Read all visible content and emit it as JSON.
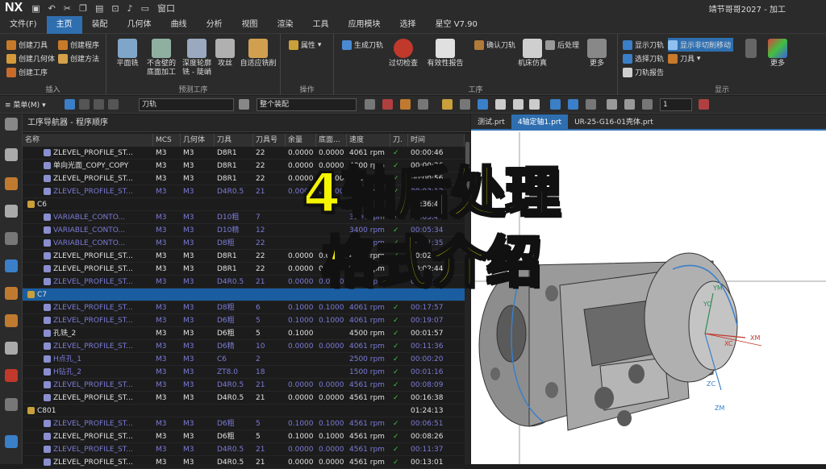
{
  "app": {
    "logo": "NX",
    "window_title": "靖节哥哥2027 - 加工",
    "window_menu": "窗口"
  },
  "menu": [
    "文件(F)",
    "主页",
    "装配",
    "几何体",
    "曲线",
    "分析",
    "视图",
    "渲染",
    "工具",
    "应用模块",
    "选择",
    "星空 V7.90"
  ],
  "menu_active_index": 1,
  "ribbon": {
    "insert": {
      "label": "插入",
      "items": [
        "创建刀具",
        "创建几何体",
        "创建工序",
        "创建程序",
        "创建方法"
      ]
    },
    "predefined": {
      "label": "预测工序",
      "items": [
        "平面铣",
        "不含壁的底面加工",
        "深度轮廓铣 - 陡峭",
        "攻丝",
        "自适应铣削"
      ]
    },
    "operation": {
      "label": "操作",
      "items": [
        "属性"
      ]
    },
    "process": {
      "label": "工序",
      "items": [
        "生成刀轨",
        "确认刀轨",
        "后处理",
        "过切检查",
        "有效性报告",
        "机床仿真",
        "更多"
      ]
    },
    "display": {
      "label": "显示",
      "items": [
        "显示刀轨",
        "显示非切削移动",
        "选择刀轨",
        "刀具",
        "刀轨报告",
        "更多"
      ]
    }
  },
  "toolbar2": {
    "menu": "菜单(M)",
    "filter": "刀轨",
    "scope": "整个装配",
    "count": "1"
  },
  "navigator": {
    "title": "工序导航器 - 程序顺序",
    "columns": [
      "名称",
      "MCS",
      "几何体",
      "刀具",
      "刀具号",
      "余量",
      "底面...",
      "速度",
      "刀.",
      "时间"
    ],
    "rows": [
      {
        "n": "ZLEVEL_PROFILE_ST...",
        "mcs": "M3",
        "g": "M3",
        "t": "D8R1",
        "no": "22",
        "r": "0.0000",
        "f": "0.0000",
        "s": "4061 rpm",
        "c": "✓",
        "time": "00:00:46",
        "lvl": 2
      },
      {
        "n": "单向光面_COPY_COPY",
        "mcs": "M3",
        "g": "M3",
        "t": "D8R1",
        "no": "22",
        "r": "0.0000",
        "f": "0.0000",
        "s": "4000 rpm",
        "c": "✓",
        "time": "00:00:26",
        "lvl": 2
      },
      {
        "n": "ZLEVEL_PROFILE_ST...",
        "mcs": "M3",
        "g": "M3",
        "t": "D8R1",
        "no": "22",
        "r": "0.0000",
        "f": "0.0000",
        "s": "4061 rpm",
        "c": "✓",
        "time": "00:00:56",
        "lvl": 2
      },
      {
        "n": "ZLEVEL_PROFILE_ST...",
        "mcs": "M3",
        "g": "M3",
        "t": "D4R0.5",
        "no": "21",
        "r": "0.0000",
        "f": "0.0000",
        "s": "4561 rpm",
        "c": "✓",
        "time": "00:03:12",
        "lvl": 2,
        "dim": true
      },
      {
        "n": "C6",
        "mcs": "",
        "g": "",
        "t": "",
        "no": "",
        "r": "",
        "f": "",
        "s": "",
        "c": "",
        "time": "01:36:45",
        "lvl": 1
      },
      {
        "n": "VARIABLE_CONTO...",
        "mcs": "M3",
        "g": "M3",
        "t": "D10粗",
        "no": "7",
        "r": "",
        "f": "",
        "s": "3200 rpm",
        "c": "✓",
        "time": "00:05:47",
        "lvl": 2,
        "dim": true
      },
      {
        "n": "VARIABLE_CONTO...",
        "mcs": "M3",
        "g": "M3",
        "t": "D10精",
        "no": "12",
        "r": "",
        "f": "",
        "s": "3400 rpm",
        "c": "✓",
        "time": "00:05:34",
        "lvl": 2,
        "dim": true
      },
      {
        "n": "VARIABLE_CONTO...",
        "mcs": "M3",
        "g": "M3",
        "t": "D8粗",
        "no": "22",
        "r": "",
        "f": "",
        "s": "3400 rpm",
        "c": "✓",
        "time": "00:11:35",
        "lvl": 2,
        "dim": true
      },
      {
        "n": "ZLEVEL_PROFILE_ST...",
        "mcs": "M3",
        "g": "M3",
        "t": "D8R1",
        "no": "22",
        "r": "0.0000",
        "f": "0.0000",
        "s": "4061 rpm",
        "c": "✓",
        "time": "00:02:12",
        "lvl": 2
      },
      {
        "n": "ZLEVEL_PROFILE_ST...",
        "mcs": "M3",
        "g": "M3",
        "t": "D8R1",
        "no": "22",
        "r": "0.0000",
        "f": "0.0000",
        "s": "4061 rpm",
        "c": "✓",
        "time": "00:02:44",
        "lvl": 2
      },
      {
        "n": "ZLEVEL_PROFILE_ST...",
        "mcs": "M3",
        "g": "M3",
        "t": "D4R0.5",
        "no": "21",
        "r": "0.0000",
        "f": "0.0000",
        "s": "4561 rpm",
        "c": "✓",
        "time": "00:03:47",
        "lvl": 2,
        "dim": true
      },
      {
        "n": "C7",
        "mcs": "",
        "g": "",
        "t": "",
        "no": "",
        "r": "",
        "f": "",
        "s": "",
        "c": "",
        "time": "",
        "lvl": 1,
        "sel": true
      },
      {
        "n": "ZLEVEL_PROFILE_ST...",
        "mcs": "M3",
        "g": "M3",
        "t": "D8粗",
        "no": "6",
        "r": "0.1000",
        "f": "0.1000",
        "s": "4061 rpm",
        "c": "✓",
        "time": "00:17:57",
        "lvl": 2,
        "dim": true
      },
      {
        "n": "ZLEVEL_PROFILE_ST...",
        "mcs": "M3",
        "g": "M3",
        "t": "D6粗",
        "no": "5",
        "r": "0.1000",
        "f": "0.1000",
        "s": "4061 rpm",
        "c": "✓",
        "time": "00:19:07",
        "lvl": 2,
        "dim": true
      },
      {
        "n": "孔铣_2",
        "mcs": "M3",
        "g": "M3",
        "t": "D6粗",
        "no": "5",
        "r": "0.1000",
        "f": "",
        "s": "4500 rpm",
        "c": "✓",
        "time": "00:01:57",
        "lvl": 2
      },
      {
        "n": "ZLEVEL_PROFILE_ST...",
        "mcs": "M3",
        "g": "M3",
        "t": "D6精",
        "no": "10",
        "r": "0.0000",
        "f": "0.0000",
        "s": "4061 rpm",
        "c": "✓",
        "time": "00:11:36",
        "lvl": 2,
        "dim": true
      },
      {
        "n": "H点孔_1",
        "mcs": "M3",
        "g": "M3",
        "t": "C6",
        "no": "2",
        "r": "",
        "f": "",
        "s": "2500 rpm",
        "c": "✓",
        "time": "00:00:20",
        "lvl": 2,
        "dim": true
      },
      {
        "n": "H钻孔_2",
        "mcs": "M3",
        "g": "M3",
        "t": "ZT8.0",
        "no": "18",
        "r": "",
        "f": "",
        "s": "1500 rpm",
        "c": "✓",
        "time": "00:01:16",
        "lvl": 2,
        "dim": true
      },
      {
        "n": "ZLEVEL_PROFILE_ST...",
        "mcs": "M3",
        "g": "M3",
        "t": "D4R0.5",
        "no": "21",
        "r": "0.0000",
        "f": "0.0000",
        "s": "4561 rpm",
        "c": "✓",
        "time": "00:08:09",
        "lvl": 2,
        "dim": true
      },
      {
        "n": "ZLEVEL_PROFILE_ST...",
        "mcs": "M3",
        "g": "M3",
        "t": "D4R0.5",
        "no": "21",
        "r": "0.0000",
        "f": "0.0000",
        "s": "4561 rpm",
        "c": "✓",
        "time": "00:16:38",
        "lvl": 2
      },
      {
        "n": "C801",
        "mcs": "",
        "g": "",
        "t": "",
        "no": "",
        "r": "",
        "f": "",
        "s": "",
        "c": "",
        "time": "01:24:13",
        "lvl": 1
      },
      {
        "n": "ZLEVEL_PROFILE_ST...",
        "mcs": "M3",
        "g": "M3",
        "t": "D6粗",
        "no": "5",
        "r": "0.1000",
        "f": "0.1000",
        "s": "4561 rpm",
        "c": "✓",
        "time": "00:06:51",
        "lvl": 2,
        "dim": true
      },
      {
        "n": "ZLEVEL_PROFILE_ST...",
        "mcs": "M3",
        "g": "M3",
        "t": "D6粗",
        "no": "5",
        "r": "0.1000",
        "f": "0.1000",
        "s": "4561 rpm",
        "c": "✓",
        "time": "00:08:26",
        "lvl": 2
      },
      {
        "n": "ZLEVEL_PROFILE_ST...",
        "mcs": "M3",
        "g": "M3",
        "t": "D4R0.5",
        "no": "21",
        "r": "0.0000",
        "f": "0.0000",
        "s": "4561 rpm",
        "c": "✓",
        "time": "00:11:37",
        "lvl": 2,
        "dim": true
      },
      {
        "n": "ZLEVEL_PROFILE_ST...",
        "mcs": "M3",
        "g": "M3",
        "t": "D4R0.5",
        "no": "21",
        "r": "0.0000",
        "f": "0.0000",
        "s": "4561 rpm",
        "c": "✓",
        "time": "00:13:01",
        "lvl": 2
      }
    ]
  },
  "viewport": {
    "tabs": [
      "测试.prt",
      "4轴定轴1.prt",
      "UR-25-G16-01壳体.prt"
    ],
    "active_tab": 1,
    "axis_labels": [
      "YM",
      "YC",
      "XC",
      "XM",
      "ZC",
      "ZM"
    ]
  },
  "overlay": {
    "line1": "4轴后处理",
    "line2": "格式介绍",
    "color": "#f5f500"
  },
  "colors": {
    "accent": "#2f6fb0",
    "check": "#3ec43e",
    "dim_text": "#7b7bd8"
  }
}
